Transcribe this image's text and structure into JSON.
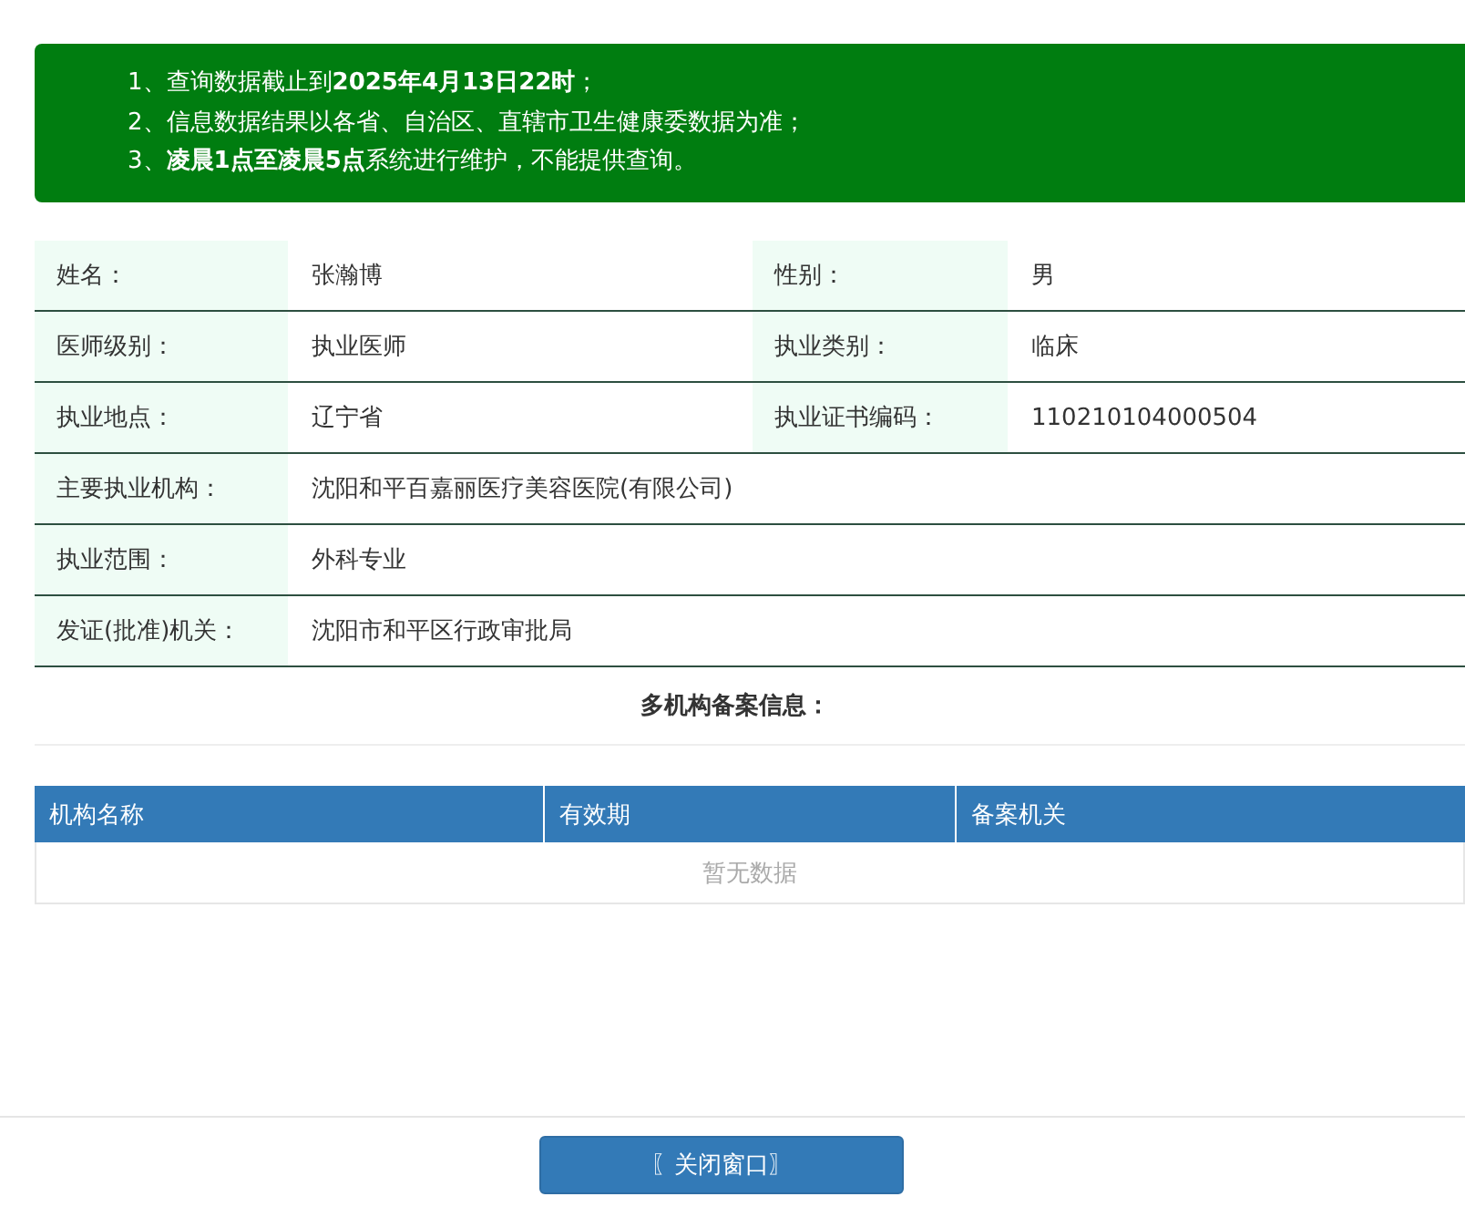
{
  "notice": [
    "1、查询数据截止到**2025年4月13日22时**；",
    "2、信息数据结果以各省、自治区、直辖市卫生健康委数据为准；",
    "3、**凌晨1点至凌晨5点**系统进行维护，不能提供查询。"
  ],
  "info_rows": [
    [
      {
        "label": "姓名：",
        "value": "张瀚博"
      },
      {
        "label": "性别：",
        "value": "男"
      }
    ],
    [
      {
        "label": "医师级别：",
        "value": "执业医师"
      },
      {
        "label": "执业类别：",
        "value": "临床"
      }
    ],
    [
      {
        "label": "执业地点：",
        "value": "辽宁省"
      },
      {
        "label": "执业证书编码：",
        "value": "110210104000504"
      }
    ],
    [
      {
        "label": "主要执业机构：",
        "value": "沈阳和平百嘉丽医疗美容医院(有限公司)"
      }
    ],
    [
      {
        "label": "执业范围：",
        "value": "外科专业"
      }
    ],
    [
      {
        "label": "发证(批准)机关：",
        "value": "沈阳市和平区行政审批局"
      }
    ]
  ],
  "multi_title": "多机构备案信息：",
  "table": {
    "columns": [
      "机构名称",
      "有效期",
      "备案机关"
    ],
    "empty_text": "暂无数据"
  },
  "close_button": "〖关闭窗口〗"
}
